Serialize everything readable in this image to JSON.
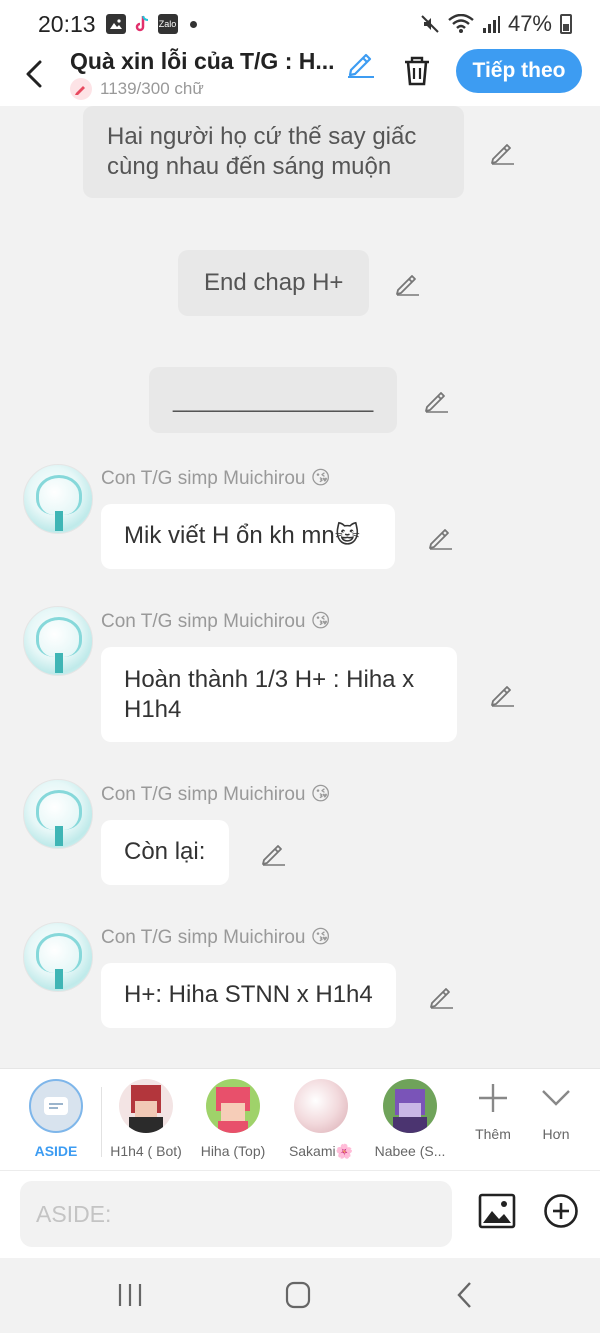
{
  "status": {
    "time": "20:13",
    "battery": "47%",
    "zalo_label": "Zalo"
  },
  "header": {
    "title": "Quà xin lỗi của T/G : H...",
    "word_count": "1139/300 chữ",
    "next_label": "Tiếp theo"
  },
  "messages": [
    {
      "type": "narration",
      "text": "Hai người họ cứ thế say giấc cùng nhau đến sáng muộn"
    },
    {
      "type": "narration",
      "text": "End chap H+"
    },
    {
      "type": "narration",
      "text": "_______________"
    },
    {
      "type": "character",
      "sender": "Con T/G simp Muichirou 😘",
      "text": "Mik viết H ổn kh mn😺"
    },
    {
      "type": "character",
      "sender": "Con T/G simp Muichirou 😘",
      "text": "Hoàn thành 1/3 H+ : Hiha x H1h4"
    },
    {
      "type": "character",
      "sender": "Con T/G simp Muichirou 😘",
      "text": "Còn lại:"
    },
    {
      "type": "character",
      "sender": "Con T/G simp Muichirou 😘",
      "text": "H+: Hiha STNN x H1h4"
    }
  ],
  "characters": [
    {
      "label": "ASIDE",
      "selected": true,
      "color": "#3d9cf2"
    },
    {
      "label": "H1h4 ( Bot)",
      "color": "#b3363c"
    },
    {
      "label": "Hiha (Top)",
      "color": "#e8506b"
    },
    {
      "label": "Sakami🌸",
      "color": "#e9c4c8"
    },
    {
      "label": "Nabee (S...",
      "color": "#7a54b8"
    }
  ],
  "tools": {
    "more_label": "Thêm",
    "less_label": "Hơn"
  },
  "input": {
    "placeholder": "ASIDE:"
  },
  "colors": {
    "accent": "#3d9cf2",
    "background": "#f2f2f2",
    "narration_bubble": "#e8e8e8"
  }
}
